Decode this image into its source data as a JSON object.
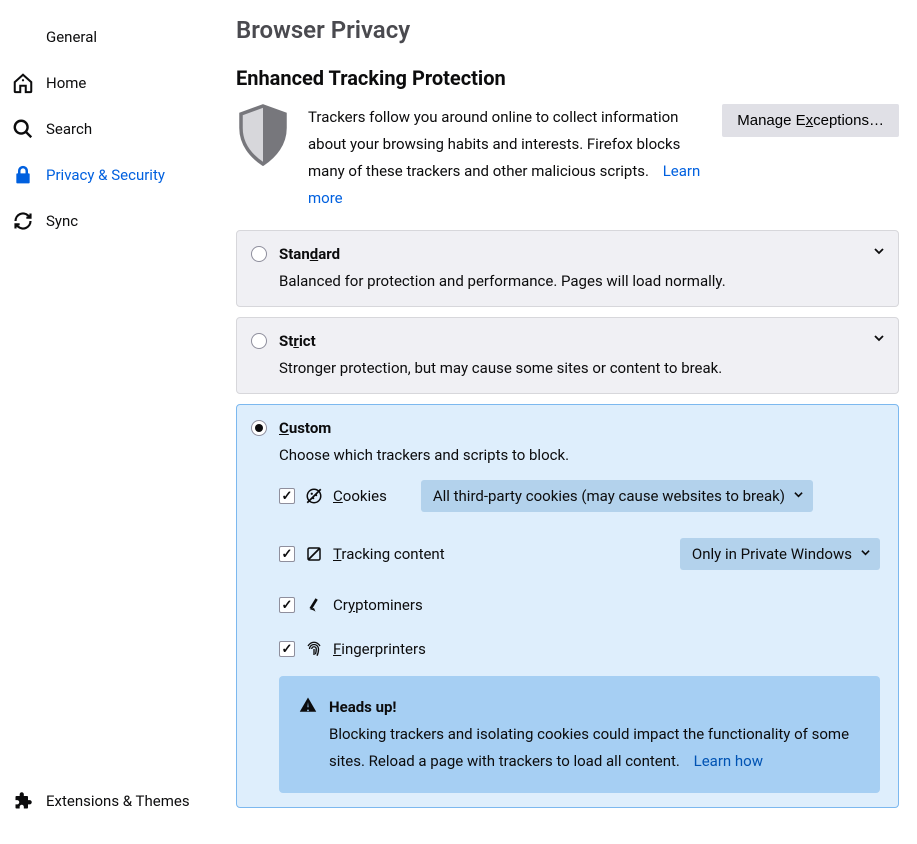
{
  "sidebar": {
    "items": [
      {
        "label": "General",
        "icon": "gear-icon"
      },
      {
        "label": "Home",
        "icon": "home-icon"
      },
      {
        "label": "Search",
        "icon": "search-icon"
      },
      {
        "label": "Privacy & Security",
        "icon": "lock-icon",
        "active": true
      },
      {
        "label": "Sync",
        "icon": "sync-icon"
      }
    ],
    "bottom": {
      "label": "Extensions & Themes",
      "icon": "puzzle-icon"
    }
  },
  "page": {
    "title": "Browser Privacy",
    "section_title": "Enhanced Tracking Protection",
    "intro": "Trackers follow you around online to collect information about your browsing habits and interests. Firefox blocks many of these trackers and other malicious scripts.",
    "learn_more": "Learn more",
    "manage_exceptions_pre": "Manage E",
    "manage_exceptions_acc": "x",
    "manage_exceptions_post": "ceptions…"
  },
  "options": {
    "standard": {
      "title_pre": "Stan",
      "title_acc": "d",
      "title_post": "ard",
      "desc": "Balanced for protection and performance. Pages will load normally."
    },
    "strict": {
      "title_pre": "St",
      "title_acc": "r",
      "title_post": "ict",
      "desc": "Stronger protection, but may cause some sites or content to break."
    },
    "custom": {
      "title_acc": "C",
      "title_post": "ustom",
      "desc": "Choose which trackers and scripts to block.",
      "selected": true,
      "checks": {
        "cookies": {
          "label_acc": "C",
          "label_post": "ookies",
          "checked": true,
          "select_value": "All third-party cookies (may cause websites to break)"
        },
        "tracking": {
          "label_acc": "T",
          "label_post": "racking content",
          "checked": true,
          "select_value": "Only in Private Windows"
        },
        "cryptominers": {
          "label_pre": "Cr",
          "label_acc": "y",
          "label_post": "ptominers",
          "checked": true
        },
        "fingerprinters": {
          "label_acc": "F",
          "label_post": "ingerprinters",
          "checked": true
        }
      },
      "warning": {
        "title": "Heads up!",
        "body": "Blocking trackers and isolating cookies could impact the functionality of some sites. Reload a page with trackers to load all content.",
        "learn_how": "Learn how"
      }
    }
  }
}
